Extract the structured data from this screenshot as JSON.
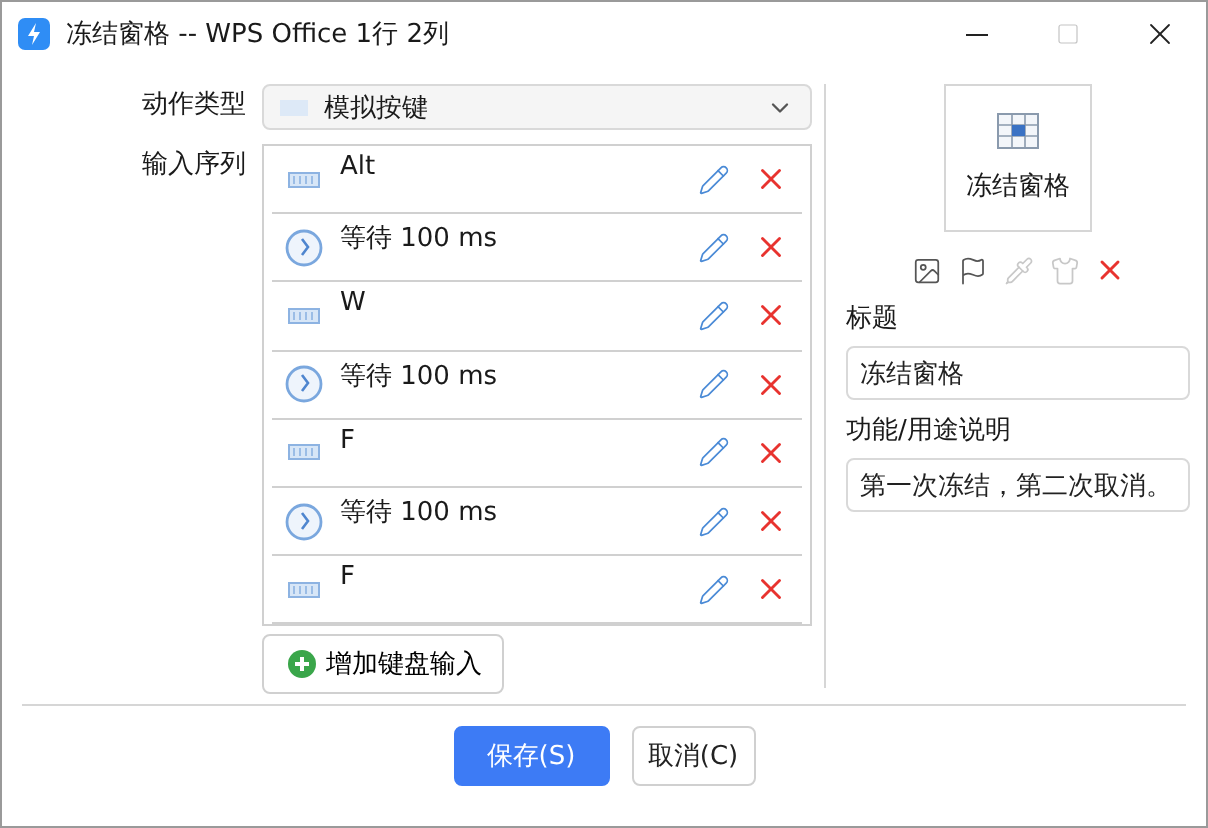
{
  "window": {
    "title": "冻结窗格 -- WPS Office 1行 2列",
    "maximize_disabled": true
  },
  "action_type": {
    "label": "动作类型",
    "value": "模拟按键"
  },
  "sequence": {
    "label": "输入序列",
    "items": [
      {
        "kind": "key",
        "text": "Alt"
      },
      {
        "kind": "wait",
        "text": "等待 100 ms"
      },
      {
        "kind": "key",
        "text": "W"
      },
      {
        "kind": "wait",
        "text": "等待 100 ms"
      },
      {
        "kind": "key",
        "text": "F"
      },
      {
        "kind": "wait",
        "text": "等待 100 ms"
      },
      {
        "kind": "key",
        "text": "F"
      }
    ],
    "add_button": "增加键盘输入"
  },
  "preview": {
    "label": "冻结窗格"
  },
  "tools": [
    {
      "kind": "image",
      "disabled": false
    },
    {
      "kind": "flag",
      "disabled": false
    },
    {
      "kind": "eyedropper",
      "disabled": true
    },
    {
      "kind": "shirt",
      "disabled": true
    },
    {
      "kind": "delete",
      "disabled": false
    }
  ],
  "title_field": {
    "label": "标题",
    "value": "冻结窗格"
  },
  "description_field": {
    "label": "功能/用途说明",
    "value": "第一次冻结，第二次取消。"
  },
  "buttons": [
    {
      "label": "保存(S)",
      "primary": true
    },
    {
      "label": "取消(C)",
      "primary": false
    }
  ]
}
